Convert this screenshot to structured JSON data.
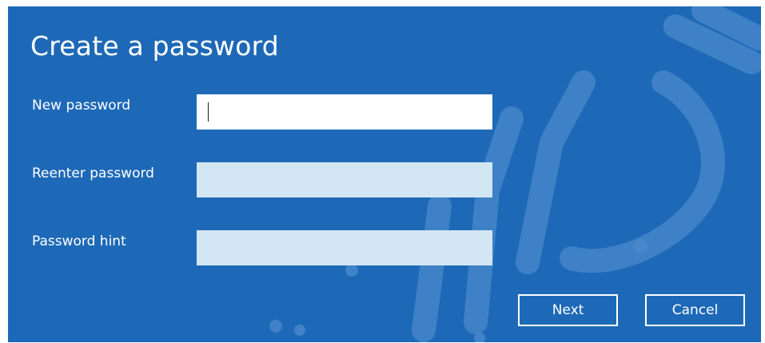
{
  "dialog": {
    "title": "Create a password",
    "fields": [
      {
        "label": "New password",
        "value": "",
        "state": "focused"
      },
      {
        "label": "Reenter password",
        "value": "",
        "state": "inactive"
      },
      {
        "label": "Password hint",
        "value": "",
        "state": "inactive"
      }
    ],
    "buttons": {
      "next_label": "Next",
      "cancel_label": "Cancel"
    }
  },
  "colors": {
    "dialog_background": "#1e69b7",
    "focused_field": "#ffffff",
    "inactive_field": "#d3e6f4",
    "text": "#ffffff"
  },
  "watermark": {
    "icon": "arabic-text-watermark"
  }
}
